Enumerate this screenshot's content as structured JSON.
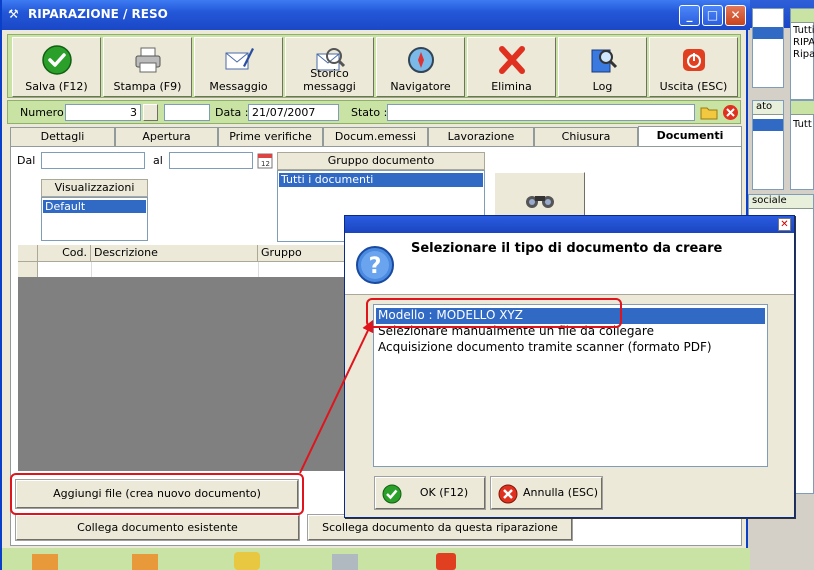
{
  "window": {
    "title": "RIPARAZIONE / RESO",
    "min": "_",
    "max": "□",
    "close": "✕"
  },
  "toolbar": {
    "buttons": [
      {
        "label": "Salva (F12)",
        "icon": "check-icon"
      },
      {
        "label": "Stampa (F9)",
        "icon": "printer-icon"
      },
      {
        "label": "Messaggio",
        "icon": "message-icon"
      },
      {
        "label": "Storico messaggi",
        "icon": "message-history-icon"
      },
      {
        "label": "Navigatore",
        "icon": "compass-icon"
      },
      {
        "label": "Elimina",
        "icon": "delete-x-icon"
      },
      {
        "label": "Log",
        "icon": "log-icon"
      },
      {
        "label": "Uscita (ESC)",
        "icon": "power-icon"
      }
    ]
  },
  "record": {
    "numero_label": "Numero :",
    "numero_value": "3",
    "data_label": "Data :",
    "data_value": "21/07/2007",
    "stato_label": "Stato :",
    "stato_value": ""
  },
  "tabs": [
    {
      "label": "Dettagli"
    },
    {
      "label": "Apertura"
    },
    {
      "label": "Prime verifiche"
    },
    {
      "label": "Docum.emessi"
    },
    {
      "label": "Lavorazione"
    },
    {
      "label": "Chiusura"
    },
    {
      "label": "Documenti",
      "active": true
    }
  ],
  "documenti": {
    "dal_label": "Dal",
    "al_label": "al",
    "dal_value": "",
    "al_value": "",
    "visualizzazioni_label": "Visualizzazioni",
    "visualizzazioni_items": [
      "Default"
    ],
    "gruppo_label": "Gruppo documento",
    "gruppo_items": [
      "Tutti i documenti"
    ],
    "grid_columns": [
      "Cod.",
      "Descrizione",
      "Gruppo"
    ],
    "add_file_button": "Aggiungi file (crea nuovo documento)",
    "link_existing_button": "Collega documento esistente",
    "unlink_button": "Scollega documento da questa riparazione"
  },
  "dialog": {
    "close": "✕",
    "heading": "Selezionare il tipo di documento da creare",
    "options": [
      "Modello : MODELLO XYZ",
      "Selezionare manualmente un file da collegare",
      "Acquisizione documento tramite scanner (formato PDF)"
    ],
    "selected_index": 0,
    "ok_label": "OK (F12)",
    "cancel_label": "Annulla (ESC)"
  },
  "background_window": {
    "panel1_items": [
      "Tutti",
      "RIPA",
      "Ripa"
    ],
    "panel2_head": "ato",
    "panel2_items": [
      "Tutt"
    ],
    "panel3_head": "sociale"
  },
  "colors": {
    "accent_green": "#c9e3a4",
    "title_blue": "#2357d9",
    "selection_blue": "#316ac5",
    "annotation_red": "#e0141c"
  }
}
